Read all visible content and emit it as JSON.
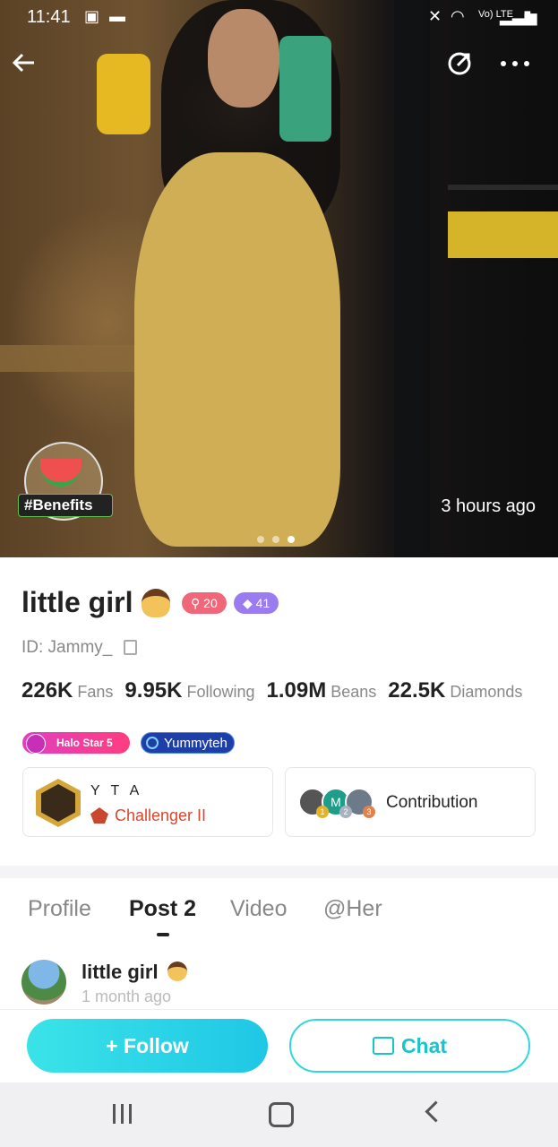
{
  "status_bar": {
    "time": "11:41",
    "network": "Vo) LTE"
  },
  "hero": {
    "time_ago": "3 hours ago",
    "benefit_tag": "#Benefits",
    "photo_index": 3,
    "photo_count": 3
  },
  "profile": {
    "name": "little girl",
    "badge_level": "20",
    "badge_gem": "41",
    "user_id": "ID: Jammy_",
    "stats": [
      {
        "value": "226K",
        "label": "Fans"
      },
      {
        "value": "9.95K",
        "label": "Following"
      },
      {
        "value": "1.09M",
        "label": "Beans"
      },
      {
        "value": "22.5K",
        "label": "Diamonds"
      }
    ],
    "tags": {
      "halo": "Halo Star 5",
      "family": "Yummyteh"
    }
  },
  "cards": {
    "family_name": "Y T A",
    "rank_title": "Challenger II",
    "contribution_label": "Contribution",
    "contributor_ranks": [
      "1",
      "2",
      "3"
    ],
    "contributor_initial": "M"
  },
  "tabs": [
    {
      "label": "Profile"
    },
    {
      "label": "Post 2"
    },
    {
      "label": "Video"
    },
    {
      "label": "@Her"
    }
  ],
  "post": {
    "author": "little girl",
    "time": "1 month ago"
  },
  "actions": {
    "follow": "+ Follow",
    "chat": "Chat"
  },
  "colors": {
    "accent": "#1fc7e6",
    "rank_red": "#d9472f",
    "badge_red": "#f0677a",
    "badge_purple": "#9b7cf0"
  },
  "icons": {
    "back": "back-arrow-icon",
    "share": "share-icon",
    "more": "more-options-icon"
  }
}
